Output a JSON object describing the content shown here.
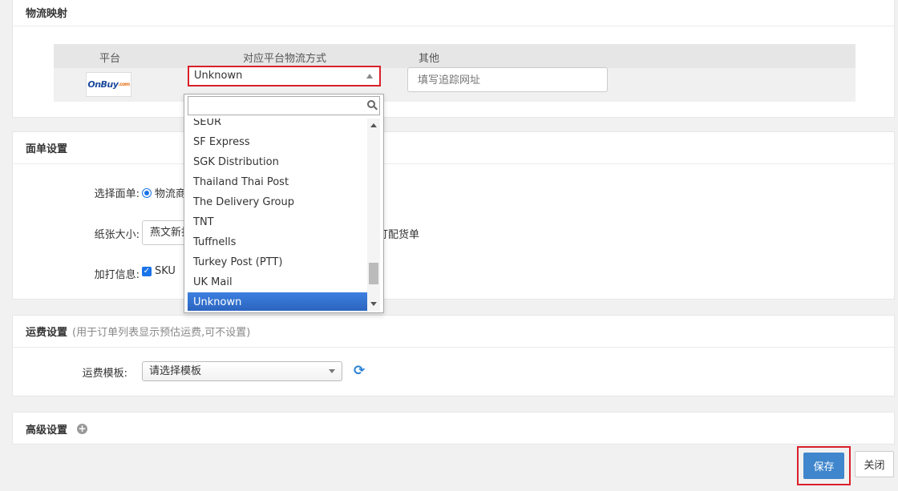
{
  "logistics_section": {
    "title": "物流映射",
    "headers": {
      "platform": "平台",
      "method": "对应平台物流方式",
      "other": "其他"
    },
    "platform_logo_text": "OnBuy",
    "platform_logo_suffix": ".com",
    "selected_method": "Unknown",
    "tracking_placeholder": "填写追踪网址"
  },
  "dropdown": {
    "search_value": "",
    "options": [
      "SEUR",
      "SF Express",
      "SGK Distribution",
      "Thailand Thai Post",
      "The Delivery Group",
      "TNT",
      "Tuffnells",
      "Turkey Post (PTT)",
      "UK Mail",
      "Unknown"
    ],
    "active_option": "Unknown"
  },
  "label_section": {
    "title": "面单设置",
    "select_label": "选择面单:",
    "radio_option": "物流商",
    "paper_label": "纸张大小:",
    "paper_value": "燕文新打",
    "paper_extra": "打配货单",
    "extra_label": "加打信息:",
    "sku_label": "SKU"
  },
  "freight_section": {
    "title": "运费设置",
    "hint": "(用于订单列表显示预估运费,可不设置)",
    "template_label": "运费模板:",
    "template_value": "请选择模板"
  },
  "advanced_section": {
    "title": "高级设置"
  },
  "buttons": {
    "save": "保存",
    "close": "关闭"
  },
  "colors": {
    "accent": "#3f86cc",
    "highlight_border": "#d9202a",
    "active_option": "#3875d7"
  }
}
